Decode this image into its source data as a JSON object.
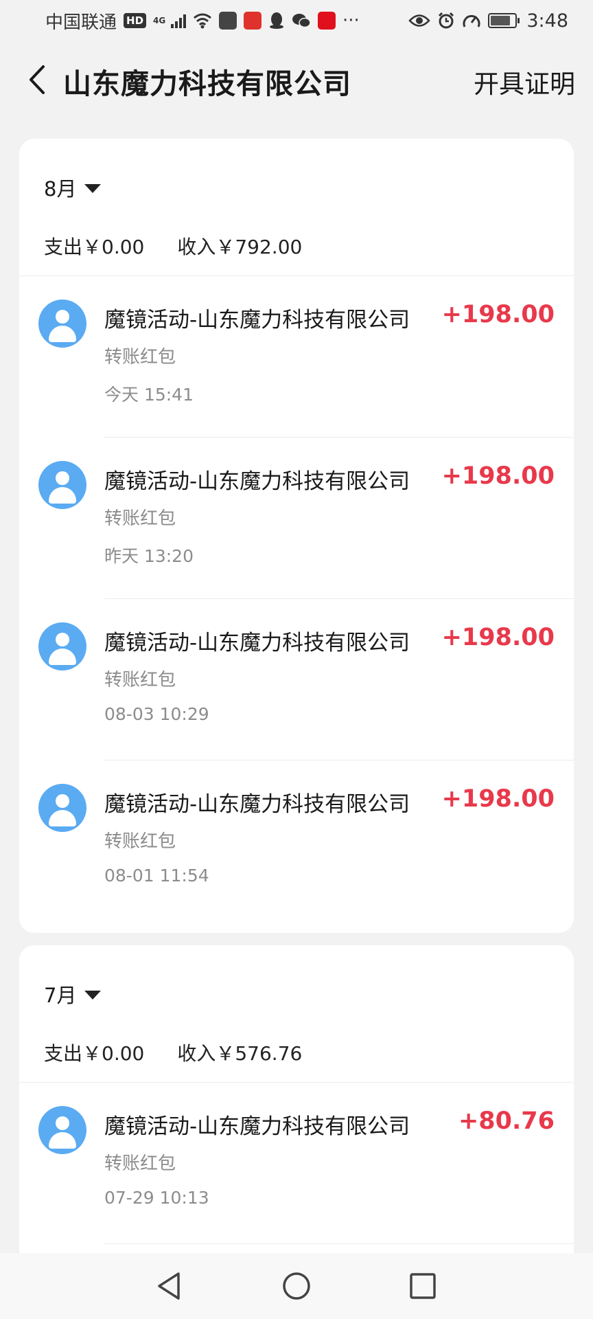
{
  "status_bar": {
    "carrier": "中国联通",
    "hd": "HD",
    "network": "4G",
    "more": "···",
    "time": "3:48"
  },
  "header": {
    "title": "山东魔力科技有限公司",
    "action": "开具证明"
  },
  "months": [
    {
      "label": "8月",
      "expense": "支出￥0.00",
      "income": "收入￥792.00",
      "transactions": [
        {
          "name": "魔镜活动-山东魔力科技有限公司",
          "type": "转账红包",
          "time": "今天 15:41",
          "amount": "+198.00"
        },
        {
          "name": "魔镜活动-山东魔力科技有限公司",
          "type": "转账红包",
          "time": "昨天 13:20",
          "amount": "+198.00"
        },
        {
          "name": "魔镜活动-山东魔力科技有限公司",
          "type": "转账红包",
          "time": "08-03 10:29",
          "amount": "+198.00"
        },
        {
          "name": "魔镜活动-山东魔力科技有限公司",
          "type": "转账红包",
          "time": "08-01 11:54",
          "amount": "+198.00"
        }
      ]
    },
    {
      "label": "7月",
      "expense": "支出￥0.00",
      "income": "收入￥576.76",
      "transactions": [
        {
          "name": "魔镜活动-山东魔力科技有限公司",
          "type": "转账红包",
          "time": "07-29 10:13",
          "amount": "+80.76"
        }
      ]
    }
  ],
  "colors": {
    "amount_positive": "#e8394b",
    "avatar": "#5aabf2",
    "secondary_text": "#8c8c8c"
  }
}
